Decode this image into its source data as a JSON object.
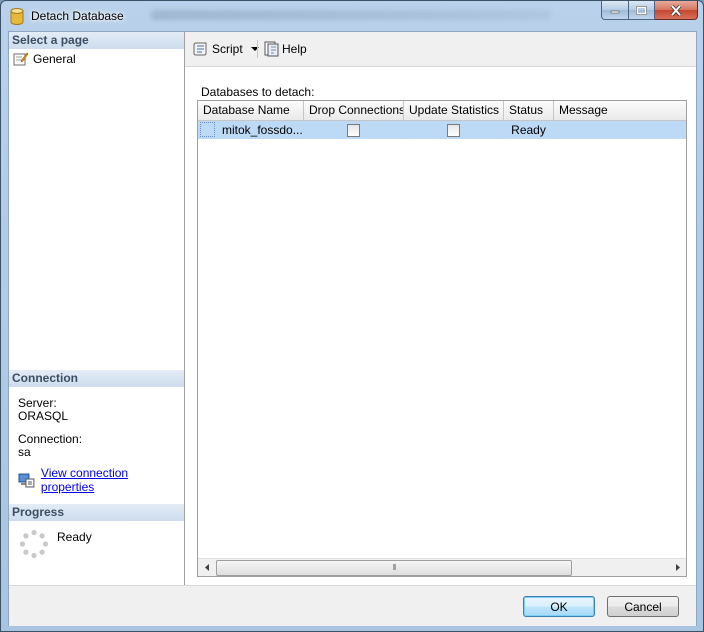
{
  "window": {
    "title": "Detach Database"
  },
  "left_pane": {
    "select_page_header": "Select a page",
    "pages": [
      {
        "label": "General",
        "icon": "page-properties-icon"
      }
    ],
    "connection_header": "Connection",
    "server_label": "Server:",
    "server_value": "ORASQL",
    "connection_label": "Connection:",
    "connection_value": "sa",
    "view_connection_link": "View connection properties",
    "progress_header": "Progress",
    "progress_status": "Ready"
  },
  "toolbar": {
    "script_label": "Script",
    "help_label": "Help"
  },
  "main": {
    "databases_label": "Databases to detach:",
    "columns": [
      "Database Name",
      "Drop Connections",
      "Update Statistics",
      "Status",
      "Message"
    ],
    "rows": [
      {
        "database_name": "mitok_fossdo...",
        "drop_connections": false,
        "update_statistics": false,
        "status": "Ready",
        "message": ""
      }
    ]
  },
  "buttons": {
    "ok": "OK",
    "cancel": "Cancel"
  }
}
